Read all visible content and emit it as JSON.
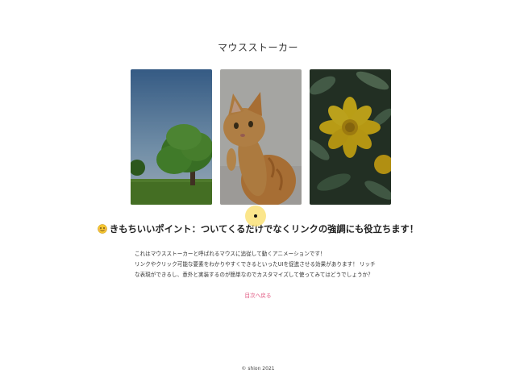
{
  "page": {
    "title": "マウスストーカー"
  },
  "gallery": {
    "items": [
      {
        "subject": "tree"
      },
      {
        "subject": "cat"
      },
      {
        "subject": "yellow flower"
      }
    ]
  },
  "headline": {
    "text": "きもちいいポイント：ついてくるだけでなくリンクの強調にも役立ちます！"
  },
  "description": {
    "line1": "これはマウスストーカーと呼ばれるマウスに追従して動くアニメーションです！",
    "line2": "リンクやクリック可能な要素をわかりやすくできるといったUIを促進させる効果があります！ リッチ",
    "line3": "な表現ができるし、意外と実装するのが簡単なのでカスタマイズして使ってみてはどうでしょうか？"
  },
  "nav": {
    "back_label": "目次へ戻る"
  },
  "footer": {
    "copyright": "© shion 2021"
  },
  "colors": {
    "link": "#e0557f",
    "stalker": "#fae278"
  }
}
